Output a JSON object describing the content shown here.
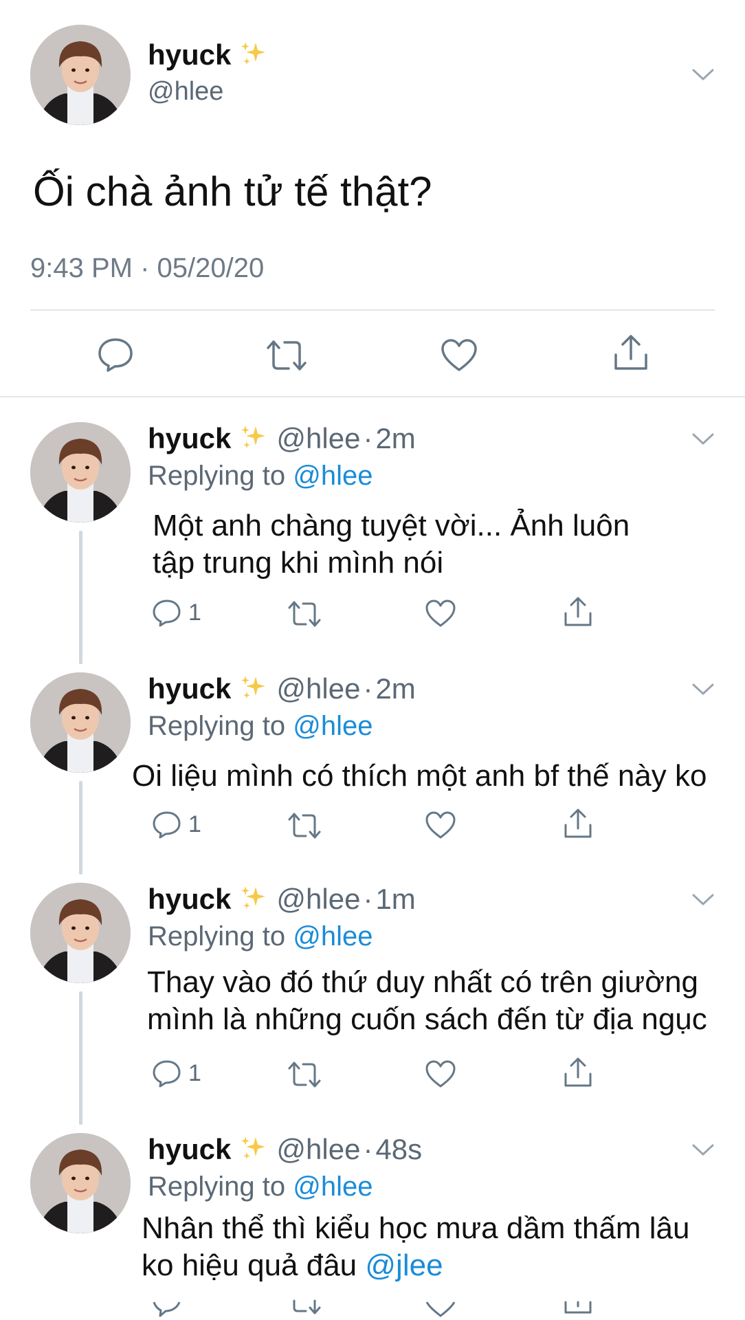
{
  "main_tweet": {
    "display_name": "hyuck",
    "name_emoji": "sparkles-emoji",
    "handle": "@hlee",
    "text": "Ối chà ảnh tử tế thật?",
    "timestamp": "9:43 PM · 05/20/20",
    "actions": [
      "reply-icon",
      "retweet-icon",
      "like-icon",
      "share-icon"
    ]
  },
  "replies": [
    {
      "display_name": "hyuck",
      "handle": "@hlee",
      "separator": "·",
      "time": "2m",
      "replying_prefix": "Replying to",
      "replying_to": "@hlee",
      "lines": [
        "Một anh chàng tuyệt vời... Ảnh luôn",
        "tập trung khi mình nói"
      ],
      "reply_count": "1"
    },
    {
      "display_name": "hyuck",
      "handle": "@hlee",
      "separator": "·",
      "time": "2m",
      "replying_prefix": "Replying to",
      "replying_to": "@hlee",
      "lines": [
        "Oi liệu mình có thích một anh bf thế này ko"
      ],
      "reply_count": "1"
    },
    {
      "display_name": "hyuck",
      "handle": "@hlee",
      "separator": "·",
      "time": "1m",
      "replying_prefix": "Replying to",
      "replying_to": "@hlee",
      "lines": [
        "Thay vào đó thứ duy nhất có trên giường",
        "mình là những cuốn sách đến từ địa ngục"
      ],
      "reply_count": "1"
    },
    {
      "display_name": "hyuck",
      "handle": "@hlee",
      "separator": "·",
      "time": "48s",
      "replying_prefix": "Replying to",
      "replying_to": "@hlee",
      "lines": [
        "Nhân thể thì kiểu học mưa dầm thấm lâu",
        "ko hiệu quả đâu"
      ],
      "line_mention": "@jlee",
      "reply_count": ""
    }
  ],
  "colors": {
    "text": "#111111",
    "muted": "#5b6875",
    "link": "#1a8cd8",
    "divider": "#e1e6ea",
    "thread_line": "#cfd8df"
  }
}
